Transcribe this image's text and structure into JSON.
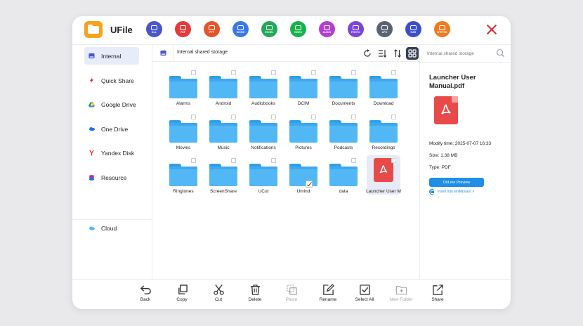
{
  "app": {
    "title": "UFile"
  },
  "filters": [
    {
      "label": "ALL",
      "icon": "layers-icon",
      "color": "#4a56c9"
    },
    {
      "label": "PDF",
      "icon": "pdf-icon",
      "color": "#e23b3b"
    },
    {
      "label": "PPT",
      "icon": "ppt-icon",
      "color": "#e6542b"
    },
    {
      "label": "WORD",
      "icon": "word-icon",
      "color": "#3a78e8"
    },
    {
      "label": "EXCEL",
      "icon": "excel-icon",
      "color": "#23a85a"
    },
    {
      "label": "VIDEO",
      "icon": "video-icon",
      "color": "#16b34a"
    },
    {
      "label": "AUDIO",
      "icon": "audio-icon",
      "color": "#b23fd1"
    },
    {
      "label": "PHOTO",
      "icon": "photo-icon",
      "color": "#7b45d8"
    },
    {
      "label": "APK",
      "icon": "android-icon",
      "color": "#5b6274"
    },
    {
      "label": "RAR",
      "icon": "archive-icon",
      "color": "#3c4fc9"
    },
    {
      "label": "WHITEB",
      "icon": "whiteboard-icon",
      "color": "#f07a1e"
    }
  ],
  "sidebar": {
    "items": [
      {
        "label": "Internal",
        "icon": "storage-icon",
        "active": true
      },
      {
        "label": "Quick Share",
        "icon": "lightning-icon",
        "active": false
      },
      {
        "label": "Google Drive",
        "icon": "google-drive-icon",
        "active": false
      },
      {
        "label": "One Drive",
        "icon": "onedrive-icon",
        "active": false
      },
      {
        "label": "Yandex Disk",
        "icon": "yandex-icon",
        "active": false
      },
      {
        "label": "Resource",
        "icon": "resource-icon",
        "active": false
      }
    ],
    "cloud": {
      "label": "Cloud",
      "icon": "cloud-icon"
    }
  },
  "path": {
    "label": "Internal shared storage"
  },
  "files": [
    {
      "name": "Alarms",
      "type": "folder"
    },
    {
      "name": "Android",
      "type": "folder"
    },
    {
      "name": "Audiobooks",
      "type": "folder"
    },
    {
      "name": "DCIM",
      "type": "folder"
    },
    {
      "name": "Documents",
      "type": "folder"
    },
    {
      "name": "Download",
      "type": "folder"
    },
    {
      "name": "Movies",
      "type": "folder"
    },
    {
      "name": "Music",
      "type": "folder"
    },
    {
      "name": "Notifications",
      "type": "folder"
    },
    {
      "name": "Pictures",
      "type": "folder"
    },
    {
      "name": "Podcasts",
      "type": "folder"
    },
    {
      "name": "Recordings",
      "type": "folder"
    },
    {
      "name": "Ringtones",
      "type": "folder"
    },
    {
      "name": "ScreenShare",
      "type": "folder"
    },
    {
      "name": "UCut",
      "type": "folder"
    },
    {
      "name": "Umind",
      "type": "folder"
    },
    {
      "name": "data",
      "type": "folder"
    },
    {
      "name": "Launcher User M",
      "type": "pdf"
    }
  ],
  "details": {
    "search_placeholder": "Internal shared storage",
    "title": "Launcher User Manual.pdf",
    "modify_time": "Modify time: 2025-07-07 16:33",
    "size": "Size: 1.38 MB",
    "type": "Type: PDF",
    "preview_label": "OnLine Preview",
    "whiteboard_label": "Insert into whiteboard >"
  },
  "toolbar": {
    "back": "Back",
    "copy": "Copy",
    "cut": "Cut",
    "delete": "Delete",
    "paste": "Paste",
    "rename": "Rename",
    "select_all": "Select All",
    "new_folder": "New Folder",
    "share": "Share"
  },
  "colors": {
    "accent": "#1f8ee6",
    "folder": "#52b8f5",
    "pdf": "#e84a4a",
    "close": "#e0292f",
    "active_bg": "#e6ecf8"
  }
}
